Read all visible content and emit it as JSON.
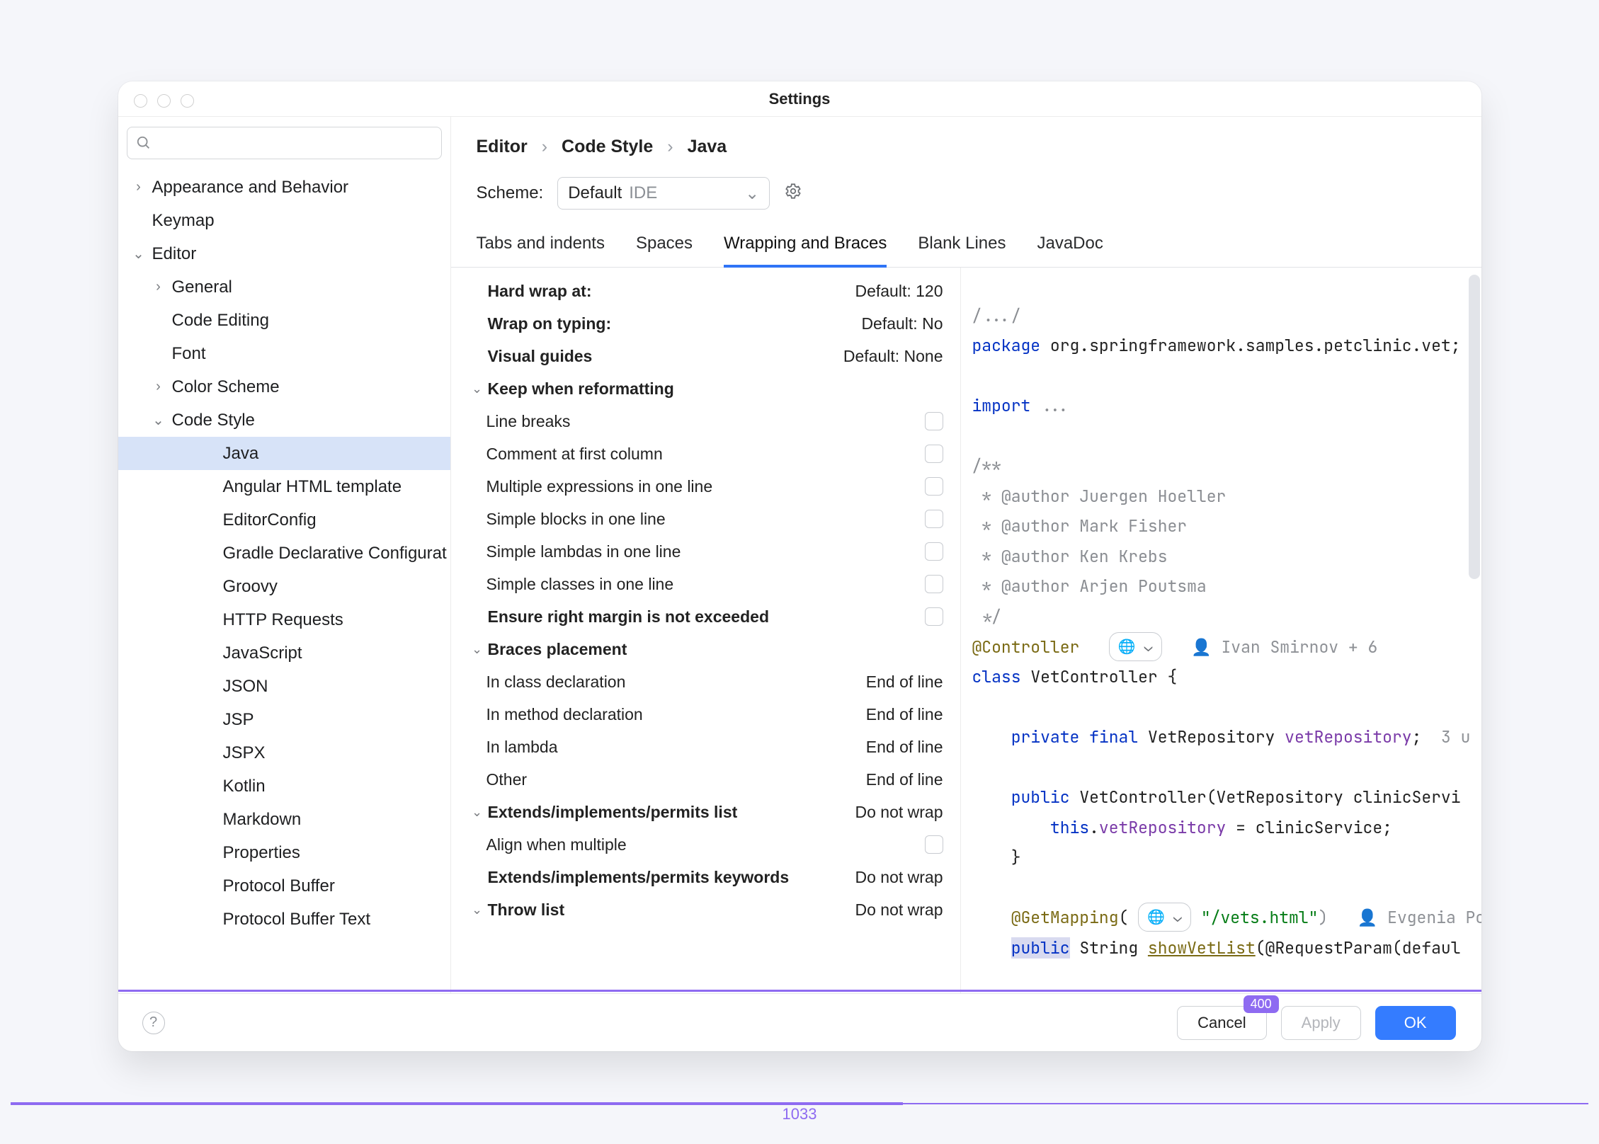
{
  "window": {
    "title": "Settings"
  },
  "sidebar": {
    "search_placeholder": "",
    "items": [
      {
        "label": "Appearance and Behavior",
        "level": 0,
        "chev": "right"
      },
      {
        "label": "Keymap",
        "level": 0,
        "chev": ""
      },
      {
        "label": "Editor",
        "level": 0,
        "chev": "down"
      },
      {
        "label": "General",
        "level": 1,
        "chev": "right"
      },
      {
        "label": "Code Editing",
        "level": 1,
        "chev": ""
      },
      {
        "label": "Font",
        "level": 1,
        "chev": ""
      },
      {
        "label": "Color Scheme",
        "level": 1,
        "chev": "right"
      },
      {
        "label": "Code Style",
        "level": 1,
        "chev": "down"
      },
      {
        "label": "Java",
        "level": 2,
        "chev": "",
        "selected": true
      },
      {
        "label": "Angular HTML template",
        "level": 2,
        "chev": ""
      },
      {
        "label": "EditorConfig",
        "level": 2,
        "chev": ""
      },
      {
        "label": "Gradle Declarative Configurat",
        "level": 2,
        "chev": ""
      },
      {
        "label": "Groovy",
        "level": 2,
        "chev": ""
      },
      {
        "label": "HTTP Requests",
        "level": 2,
        "chev": ""
      },
      {
        "label": "JavaScript",
        "level": 2,
        "chev": ""
      },
      {
        "label": "JSON",
        "level": 2,
        "chev": ""
      },
      {
        "label": "JSP",
        "level": 2,
        "chev": ""
      },
      {
        "label": "JSPX",
        "level": 2,
        "chev": ""
      },
      {
        "label": "Kotlin",
        "level": 2,
        "chev": ""
      },
      {
        "label": "Markdown",
        "level": 2,
        "chev": ""
      },
      {
        "label": "Properties",
        "level": 2,
        "chev": ""
      },
      {
        "label": "Protocol Buffer",
        "level": 2,
        "chev": ""
      },
      {
        "label": "Protocol Buffer Text",
        "level": 2,
        "chev": ""
      }
    ]
  },
  "breadcrumb": {
    "a": "Editor",
    "b": "Code Style",
    "c": "Java"
  },
  "scheme": {
    "label": "Scheme:",
    "value": "Default",
    "tag": "IDE"
  },
  "tabs": [
    "Tabs and indents",
    "Spaces",
    "Wrapping and Braces",
    "Blank Lines",
    "JavaDoc"
  ],
  "options": [
    {
      "label": "Hard wrap at:",
      "bold": true,
      "indent": 0,
      "value": "Default: 120"
    },
    {
      "label": "Wrap on typing:",
      "bold": true,
      "indent": 0,
      "value": "Default: No"
    },
    {
      "label": "Visual guides",
      "bold": true,
      "indent": 0,
      "value": "Default: None"
    },
    {
      "label": "Keep when reformatting",
      "bold": true,
      "indent": 0,
      "collapse": true
    },
    {
      "label": "Line breaks",
      "bold": false,
      "indent": 1,
      "checkbox": true
    },
    {
      "label": "Comment at first column",
      "bold": false,
      "indent": 1,
      "checkbox": true
    },
    {
      "label": "Multiple expressions in one line",
      "bold": false,
      "indent": 1,
      "checkbox": true
    },
    {
      "label": "Simple blocks in one line",
      "bold": false,
      "indent": 1,
      "checkbox": true
    },
    {
      "label": "Simple lambdas in one line",
      "bold": false,
      "indent": 1,
      "checkbox": true
    },
    {
      "label": "Simple classes in one line",
      "bold": false,
      "indent": 1,
      "checkbox": true
    },
    {
      "label": "Ensure right margin is not exceeded",
      "bold": true,
      "indent": 0,
      "checkbox": true
    },
    {
      "label": "Braces placement",
      "bold": true,
      "indent": 0,
      "collapse": true
    },
    {
      "label": "In class declaration",
      "bold": false,
      "indent": 1,
      "value": "End of line"
    },
    {
      "label": "In method declaration",
      "bold": false,
      "indent": 1,
      "value": "End of line"
    },
    {
      "label": "In lambda",
      "bold": false,
      "indent": 1,
      "value": "End of line"
    },
    {
      "label": "Other",
      "bold": false,
      "indent": 1,
      "value": "End of line"
    },
    {
      "label": "Extends/implements/permits list",
      "bold": true,
      "indent": 0,
      "collapse": true,
      "value": "Do not wrap"
    },
    {
      "label": "Align when multiple",
      "bold": false,
      "indent": 1,
      "checkbox": true
    },
    {
      "label": "Extends/implements/permits keywords",
      "bold": true,
      "indent": 0,
      "value": "Do not wrap"
    },
    {
      "label": "Throw list",
      "bold": true,
      "indent": 0,
      "collapse": true,
      "value": "Do not wrap"
    }
  ],
  "preview": {
    "l1": "/.../",
    "l2a": "package",
    "l2b": " org.springframework.samples.petclinic.vet;",
    "l3a": "import",
    "l3b": " ...",
    "l4": "/**",
    "l5": " * @author Juergen Hoeller",
    "l6": " * @author Mark Fisher",
    "l7": " * @author Ken Krebs",
    "l8": " * @author Arjen Poutsma",
    "l9": " */",
    "l10a": "@Controller",
    "l10_hint": "Ivan Smirnov + 6",
    "l11a": "class",
    "l11b": " VetController {",
    "l12a": "private",
    "l12b": "final",
    "l12c": " VetRepository ",
    "l12d": "vetRepository",
    "l12e": ";",
    "l12_hint": "3 u",
    "l13a": "public",
    "l13b": " ",
    "l13c": "VetController",
    "l13d": "(VetRepository clinicServi",
    "l14a": "this",
    "l14b": ".",
    "l14c": "vetRepository",
    "l14d": " = clinicService;",
    "l15": "    }",
    "l16a": "@GetMapping",
    "l16b": "(",
    "l16c": "\"/vets.html\"",
    "l16d": ")",
    "l16_hint": "Evgenia Popo",
    "l17a": "public",
    "l17b": " String ",
    "l17c": "showVetList",
    "l17d": "(@RequestParam(defaul"
  },
  "footer": {
    "cancel": "Cancel",
    "apply": "Apply",
    "ok": "OK",
    "badge": "400"
  },
  "width_label": "1033"
}
